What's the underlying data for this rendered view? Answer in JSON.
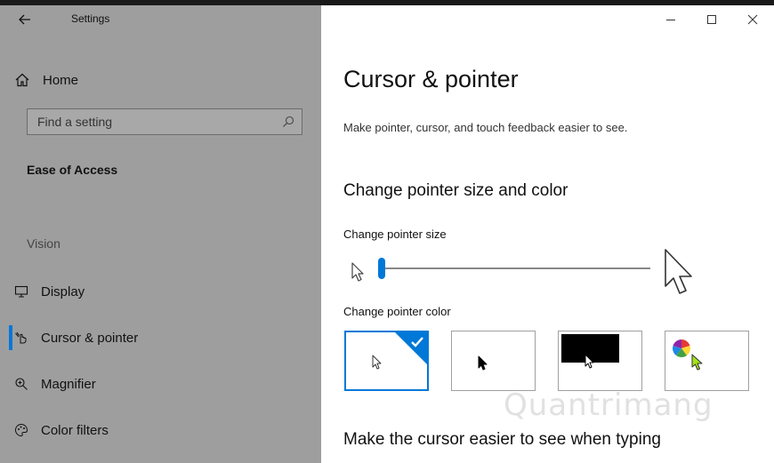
{
  "window": {
    "title": "Settings",
    "back_icon": "back-arrow-icon",
    "minimize_icon": "minimize-icon",
    "maximize_icon": "maximize-icon",
    "close_icon": "close-icon"
  },
  "sidebar": {
    "home_label": "Home",
    "home_icon": "home-icon",
    "search_placeholder": "Find a setting",
    "search_icon": "search-icon",
    "section_title": "Ease of Access",
    "group_label": "Vision",
    "items": [
      {
        "label": "Display",
        "icon": "display-icon",
        "selected": false
      },
      {
        "label": "Cursor & pointer",
        "icon": "cursor-pointer-icon",
        "selected": true
      },
      {
        "label": "Magnifier",
        "icon": "magnifier-icon",
        "selected": false
      },
      {
        "label": "Color filters",
        "icon": "color-filters-icon",
        "selected": false
      }
    ]
  },
  "main": {
    "title": "Cursor & pointer",
    "description": "Make pointer, cursor, and touch feedback easier to see.",
    "section_heading": "Change pointer size and color",
    "size_label": "Change pointer size",
    "size_value": 0.0,
    "color_label": "Change pointer color",
    "color_options": [
      {
        "name": "white",
        "selected": true
      },
      {
        "name": "black",
        "selected": false
      },
      {
        "name": "inverted",
        "selected": false
      },
      {
        "name": "custom",
        "selected": false
      }
    ],
    "cursor_heading": "Make the cursor easier to see when typing"
  },
  "watermark": "Quantrimang",
  "colors": {
    "accent": "#0078d7",
    "sidebar_bg": "#9e9e9e",
    "custom_pointer": "#a5e21b"
  }
}
